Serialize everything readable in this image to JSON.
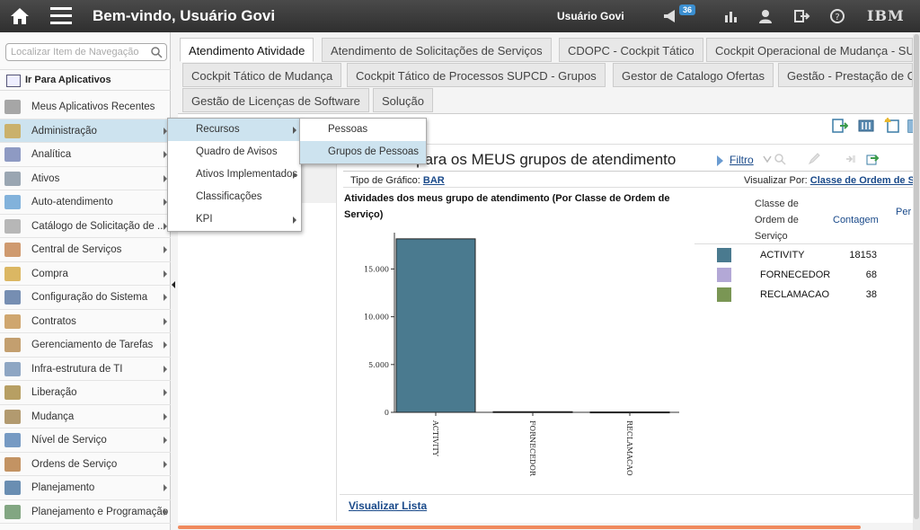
{
  "header": {
    "welcome": "Bem-vindo, Usuário Govi",
    "user_name": "Usuário Govi",
    "notifications_count": "36",
    "brand": "IBM"
  },
  "sidebar": {
    "search_placeholder": "Localizar Item de Navegação",
    "goto_label": "Ir Para Aplicativos",
    "items": [
      {
        "label": "Meus Aplicativos Recentes",
        "icon": "recent-apps-icon"
      },
      {
        "label": "Administração",
        "icon": "admin-icon"
      },
      {
        "label": "Analítica",
        "icon": "analytics-icon"
      },
      {
        "label": "Ativos",
        "icon": "assets-icon"
      },
      {
        "label": "Auto-atendimento",
        "icon": "self-service-icon"
      },
      {
        "label": "Catálogo de Solicitação de ...",
        "icon": "catalog-icon"
      },
      {
        "label": "Central de Serviços",
        "icon": "service-desk-icon"
      },
      {
        "label": "Compra",
        "icon": "purchase-icon"
      },
      {
        "label": "Configuração do Sistema",
        "icon": "system-config-icon"
      },
      {
        "label": "Contratos",
        "icon": "contracts-icon"
      },
      {
        "label": "Gerenciamento de Tarefas",
        "icon": "task-management-icon"
      },
      {
        "label": "Infra-estrutura de TI",
        "icon": "it-infrastructure-icon"
      },
      {
        "label": "Liberação",
        "icon": "release-icon"
      },
      {
        "label": "Mudança",
        "icon": "change-icon"
      },
      {
        "label": "Nível de Serviço",
        "icon": "service-level-icon"
      },
      {
        "label": "Ordens de Serviço",
        "icon": "work-orders-icon"
      },
      {
        "label": "Planejamento",
        "icon": "planning-icon"
      },
      {
        "label": "Planejamento e Programação",
        "icon": "scheduling-icon"
      }
    ]
  },
  "submenu_admin": [
    "Recursos",
    "Quadro de Avisos",
    "Ativos Implementados",
    "Classificações",
    "KPI"
  ],
  "submenu_recursos": [
    "Pessoas",
    "Grupos de Pessoas"
  ],
  "tabs": [
    "Atendimento Atividade",
    "Atendimento de Solicitações de Serviços",
    "CDOPC - Cockpit Tático",
    "Cockpit Operacional de Mudança - SU",
    "Cockpit Tático de Mudança",
    "Cockpit Tático de Processos SUPCD - Grupos",
    "Gestor de Catalogo Ofertas",
    "Gestão - Prestação de C",
    "Gestão de Licenças de Software",
    "Solução"
  ],
  "panel": {
    "title": "Atividades para os MEUS grupos de atendimento",
    "filter_label": "Filtro",
    "chart_type_label": "Tipo de Gráfico:",
    "chart_type_value": "BAR",
    "view_by_label": "Visualizar Por:",
    "view_by_value": "Classe de Ordem de S",
    "chart_title": "Atividades dos meus grupo de atendimento (Por Classe de Ordem de Serviço)",
    "legend_col1": "Classe de Ordem de Serviço",
    "legend_col2": "Contagem",
    "legend_col3": "Per",
    "view_list": "Visualizar Lista"
  },
  "chart_data": {
    "type": "bar",
    "categories": [
      "ACTIVITY",
      "FORNECEDOR",
      "RECLAMACAO"
    ],
    "values": [
      18153,
      68,
      38
    ],
    "colors": [
      "#4a7a8f",
      "#b3a8d6",
      "#7a9654"
    ],
    "y_ticks": [
      "0",
      "5.000",
      "10.000",
      "15.000"
    ],
    "ylim": [
      0,
      18800
    ],
    "grid": false
  }
}
